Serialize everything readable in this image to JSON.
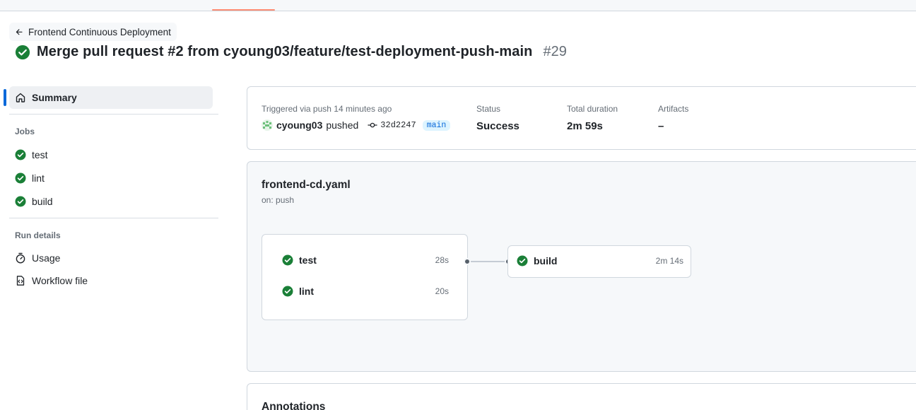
{
  "back_link": {
    "label": "Frontend Continuous Deployment"
  },
  "run": {
    "title": "Merge pull request #2 from cyoung03/feature/test-deployment-push-main",
    "number": "#29"
  },
  "sidebar": {
    "summary_label": "Summary",
    "jobs_heading": "Jobs",
    "jobs": [
      {
        "label": "test"
      },
      {
        "label": "lint"
      },
      {
        "label": "build"
      }
    ],
    "run_details_heading": "Run details",
    "details": [
      {
        "label": "Usage",
        "icon": "stopwatch-icon"
      },
      {
        "label": "Workflow file",
        "icon": "workflow-file-icon"
      }
    ]
  },
  "summary": {
    "triggered": "Triggered via push 14 minutes ago",
    "actor": "cyoung03",
    "action": "pushed",
    "commit": "32d2247",
    "branch": "main",
    "status_label": "Status",
    "status_value": "Success",
    "duration_label": "Total duration",
    "duration_value": "2m 59s",
    "artifacts_label": "Artifacts",
    "artifacts_value": "–"
  },
  "workflow": {
    "file": "frontend-cd.yaml",
    "trigger": "on: push",
    "group1": [
      {
        "name": "test",
        "duration": "28s"
      },
      {
        "name": "lint",
        "duration": "20s"
      }
    ],
    "group2": [
      {
        "name": "build",
        "duration": "2m 14s"
      }
    ]
  },
  "annotations": {
    "title": "Annotations"
  },
  "colors": {
    "success": "#1a7f37",
    "accent": "#0969da",
    "tab_underline": "#fd8c73"
  }
}
